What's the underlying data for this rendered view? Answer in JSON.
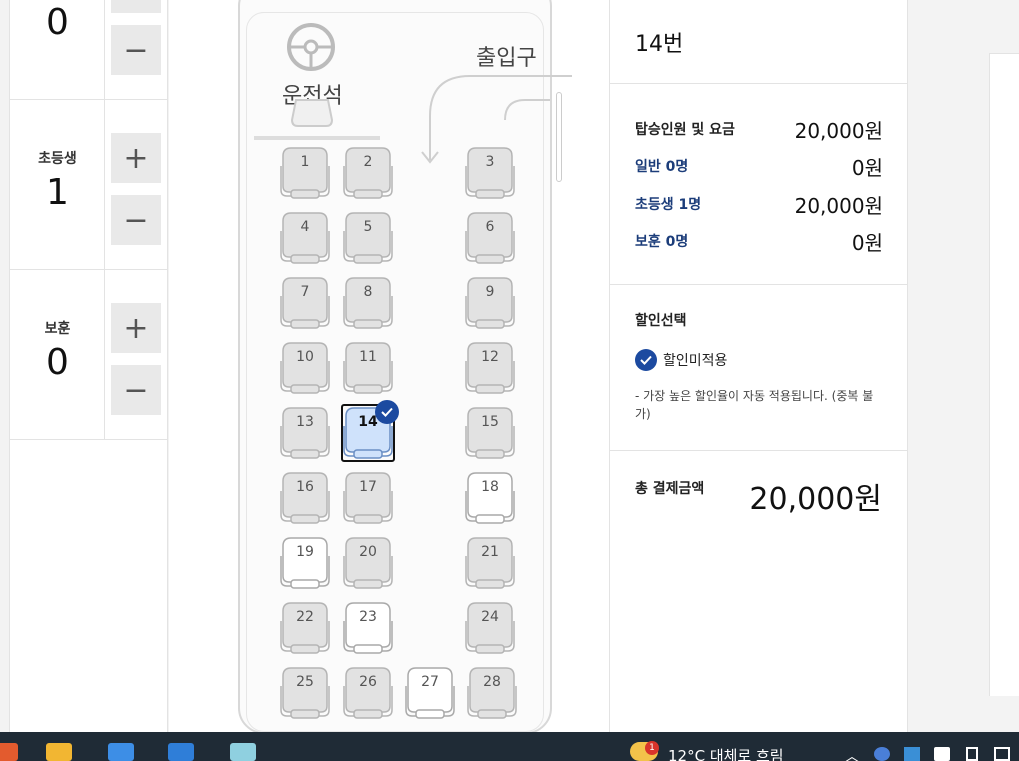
{
  "counts": [
    {
      "label": "",
      "value": "0",
      "plus": "+",
      "minus": "−"
    },
    {
      "label": "초등생",
      "value": "1",
      "plus": "+",
      "minus": "−"
    },
    {
      "label": "보훈",
      "value": "0",
      "plus": "+",
      "minus": "−"
    }
  ],
  "seatmap": {
    "driver_label": "운전석",
    "entrance_label": "출입구",
    "seats": [
      {
        "num": "1",
        "state": "taken"
      },
      {
        "num": "2",
        "state": "taken"
      },
      {
        "num": "3",
        "state": "taken"
      },
      {
        "num": "4",
        "state": "taken"
      },
      {
        "num": "5",
        "state": "taken"
      },
      {
        "num": "6",
        "state": "taken"
      },
      {
        "num": "7",
        "state": "taken"
      },
      {
        "num": "8",
        "state": "taken"
      },
      {
        "num": "9",
        "state": "taken"
      },
      {
        "num": "10",
        "state": "taken"
      },
      {
        "num": "11",
        "state": "taken"
      },
      {
        "num": "12",
        "state": "taken"
      },
      {
        "num": "13",
        "state": "taken"
      },
      {
        "num": "14",
        "state": "selected"
      },
      {
        "num": "15",
        "state": "taken"
      },
      {
        "num": "16",
        "state": "taken"
      },
      {
        "num": "17",
        "state": "taken"
      },
      {
        "num": "18",
        "state": "available"
      },
      {
        "num": "19",
        "state": "available"
      },
      {
        "num": "20",
        "state": "taken"
      },
      {
        "num": "21",
        "state": "taken"
      },
      {
        "num": "22",
        "state": "taken"
      },
      {
        "num": "23",
        "state": "available"
      },
      {
        "num": "24",
        "state": "taken"
      },
      {
        "num": "25",
        "state": "taken"
      },
      {
        "num": "26",
        "state": "taken"
      },
      {
        "num": "27",
        "state": "available"
      },
      {
        "num": "28",
        "state": "taken"
      }
    ]
  },
  "summary": {
    "seat_number": "14번",
    "fare_title": "탑승인원 및 요금",
    "fare_total": "20,000원",
    "rows": [
      {
        "label": "일반 0명",
        "value": "0원"
      },
      {
        "label": "초등생 1명",
        "value": "20,000원"
      },
      {
        "label": "보훈 0명",
        "value": "0원"
      }
    ],
    "discount_title": "할인선택",
    "discount_option": "할인미적용",
    "discount_note": "- 가장 높은 할인율이 자동 적용됩니다. (중복 불가)",
    "total_label": "총 결제금액",
    "total_value": "20,000원"
  },
  "taskbar": {
    "weather": "12°C  대체로 흐림",
    "weather_badge": "1"
  },
  "colors": {
    "accent": "#1c4aa0",
    "seat_taken": "#e2e2e2",
    "seat_selected": "#cfe2fb"
  }
}
